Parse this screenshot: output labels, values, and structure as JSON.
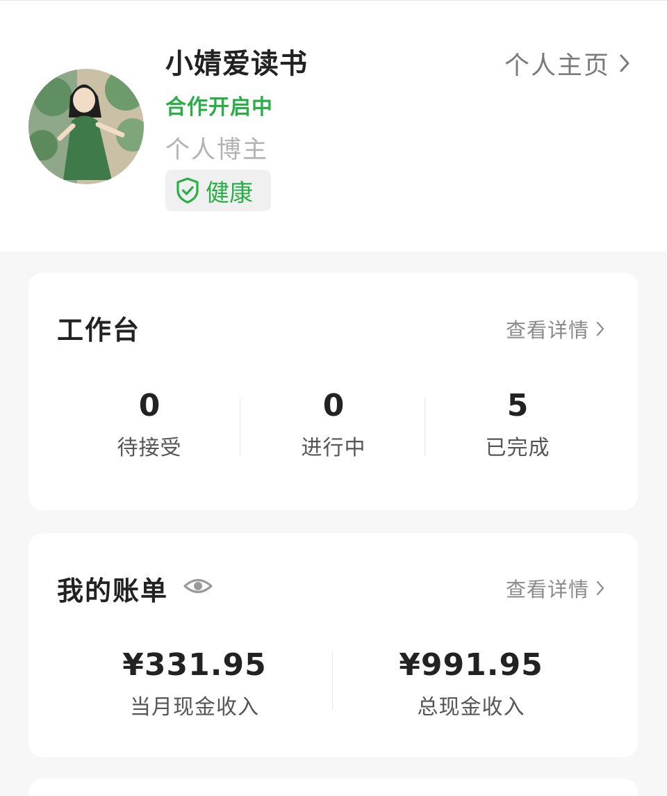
{
  "profile": {
    "name": "小婧爱读书",
    "status": "合作开启中",
    "role": "个人博主",
    "health_label": "健康",
    "homepage_label": "个人主页"
  },
  "workbench": {
    "title": "工作台",
    "detail_label": "查看详情",
    "stats": [
      {
        "value": "0",
        "label": "待接受"
      },
      {
        "value": "0",
        "label": "进行中"
      },
      {
        "value": "5",
        "label": "已完成"
      }
    ]
  },
  "bill": {
    "title": "我的账单",
    "detail_label": "查看详情",
    "items": [
      {
        "value": "¥331.95",
        "label": "当月现金收入"
      },
      {
        "value": "¥991.95",
        "label": "总现金收入"
      }
    ]
  },
  "colors": {
    "accent_green": "#2aae47",
    "page_bg": "#f7f7f7"
  }
}
